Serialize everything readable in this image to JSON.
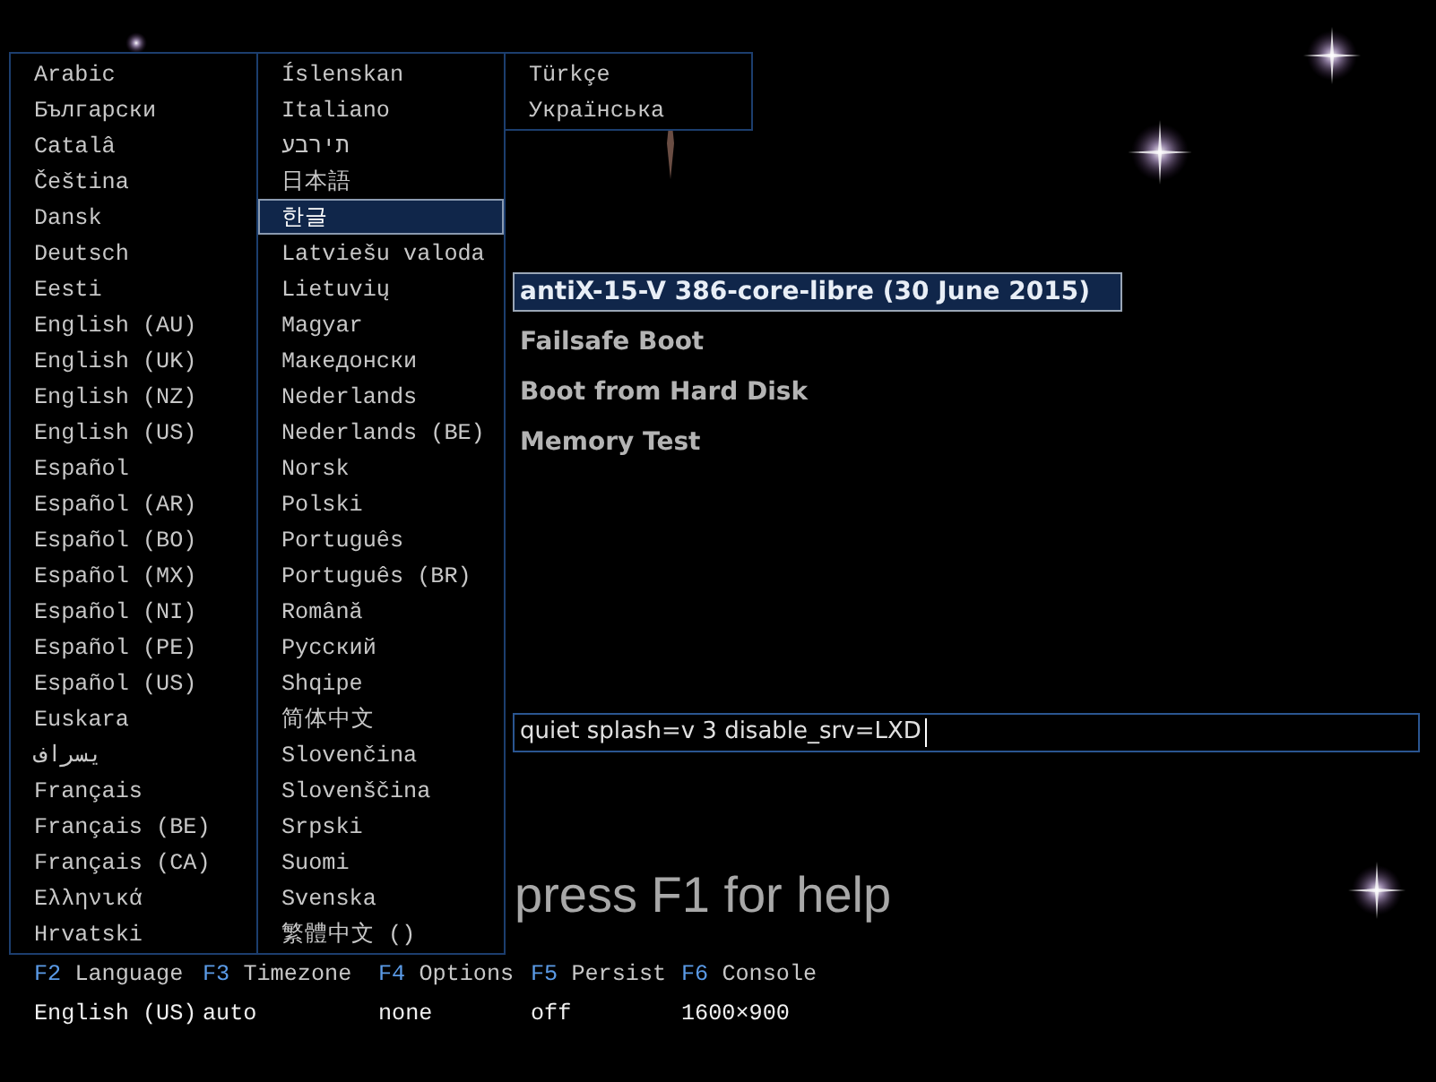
{
  "language_menu": {
    "columns": [
      [
        {
          "label": "Arabic",
          "selected": false
        },
        {
          "label": "Български",
          "selected": false
        },
        {
          "label": "Catalâ",
          "selected": false
        },
        {
          "label": "Čeština",
          "selected": false
        },
        {
          "label": "Dansk",
          "selected": false
        },
        {
          "label": "Deutsch",
          "selected": false
        },
        {
          "label": "Eesti",
          "selected": false
        },
        {
          "label": "English (AU)",
          "selected": false
        },
        {
          "label": "English (UK)",
          "selected": false
        },
        {
          "label": "English (NZ)",
          "selected": false
        },
        {
          "label": "English (US)",
          "selected": false
        },
        {
          "label": "Español",
          "selected": false
        },
        {
          "label": "Español (AR)",
          "selected": false
        },
        {
          "label": "Español (BO)",
          "selected": false
        },
        {
          "label": "Español (MX)",
          "selected": false
        },
        {
          "label": "Español (NI)",
          "selected": false
        },
        {
          "label": "Español (PE)",
          "selected": false
        },
        {
          "label": "Español (US)",
          "selected": false
        },
        {
          "label": "Euskara",
          "selected": false
        },
        {
          "label": "فارسی",
          "selected": false
        },
        {
          "label": "Français",
          "selected": false
        },
        {
          "label": "Français (BE)",
          "selected": false
        },
        {
          "label": "Français (CA)",
          "selected": false
        },
        {
          "label": "Ελληνικά",
          "selected": false
        },
        {
          "label": "Hrvatski",
          "selected": false
        }
      ],
      [
        {
          "label": "Íslenskan",
          "selected": false
        },
        {
          "label": "Italiano",
          "selected": false
        },
        {
          "label": "עברית",
          "selected": false
        },
        {
          "label": "日本語",
          "selected": false
        },
        {
          "label": "한글",
          "selected": true
        },
        {
          "label": "Latviešu valoda",
          "selected": false
        },
        {
          "label": "Lietuvių",
          "selected": false
        },
        {
          "label": "Magyar",
          "selected": false
        },
        {
          "label": "Македонски",
          "selected": false
        },
        {
          "label": "Nederlands",
          "selected": false
        },
        {
          "label": "Nederlands (BE)",
          "selected": false
        },
        {
          "label": "Norsk",
          "selected": false
        },
        {
          "label": "Polski",
          "selected": false
        },
        {
          "label": "Português",
          "selected": false
        },
        {
          "label": "Português (BR)",
          "selected": false
        },
        {
          "label": "Română",
          "selected": false
        },
        {
          "label": "Русский",
          "selected": false
        },
        {
          "label": "Shqipe",
          "selected": false
        },
        {
          "label": "简体中文",
          "selected": false
        },
        {
          "label": "Slovenčina",
          "selected": false
        },
        {
          "label": "Slovenščina",
          "selected": false
        },
        {
          "label": "Srpski",
          "selected": false
        },
        {
          "label": "Suomi",
          "selected": false
        },
        {
          "label": "Svenska",
          "selected": false
        },
        {
          "label": "繁體中文 ()",
          "selected": false
        }
      ],
      [
        {
          "label": "Türkçe",
          "selected": false
        },
        {
          "label": "Українська",
          "selected": false
        }
      ]
    ]
  },
  "boot_menu": {
    "items": [
      {
        "label": "antiX-15-V 386-core-libre (30 June 2015)",
        "selected": true
      },
      {
        "label": "Failsafe Boot",
        "selected": false
      },
      {
        "label": "Boot from Hard Disk",
        "selected": false
      },
      {
        "label": "Memory Test",
        "selected": false
      }
    ]
  },
  "boot_options": {
    "value": "quiet splash=v 3 disable_srv=LXD"
  },
  "help_hint": "press F1 for help",
  "function_keys": [
    {
      "key": "F2",
      "label": "Language",
      "value": "English (US)"
    },
    {
      "key": "F3",
      "label": "Timezone",
      "value": "auto"
    },
    {
      "key": "F4",
      "label": "Options",
      "value": "none"
    },
    {
      "key": "F5",
      "label": "Persist",
      "value": "off"
    },
    {
      "key": "F6",
      "label": "Console",
      "value": "1600×900"
    }
  ]
}
